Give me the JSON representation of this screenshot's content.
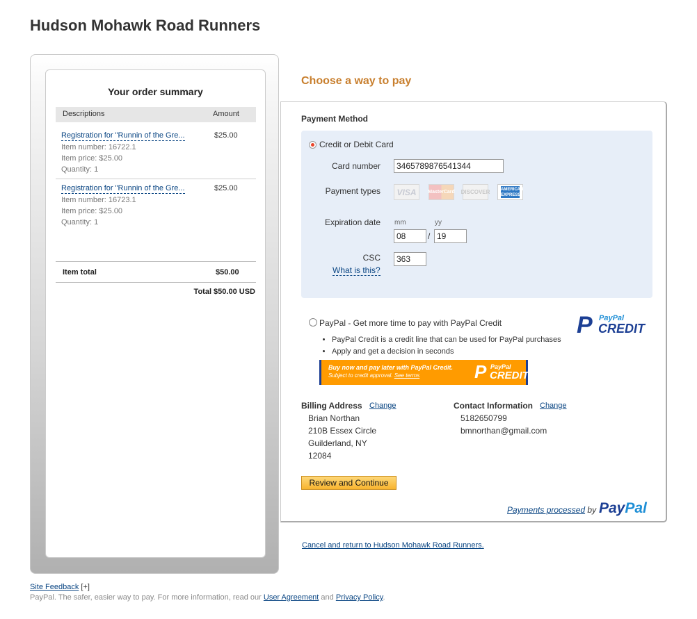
{
  "merchant": {
    "title": "Hudson Mohawk Road Runners"
  },
  "summary": {
    "title": "Your order summary",
    "col_desc": "Descriptions",
    "col_amount": "Amount",
    "items": [
      {
        "name": "Registration for \"Runnin of the Gre...",
        "amount": "$25.00",
        "item_number": "Item number: 16722.1",
        "item_price": "Item price: $25.00",
        "quantity": "Quantity: 1"
      },
      {
        "name": "Registration for \"Runnin of the Gre...",
        "amount": "$25.00",
        "item_number": "Item number: 16723.1",
        "item_price": "Item price: $25.00",
        "quantity": "Quantity: 1"
      }
    ],
    "item_total_label": "Item total",
    "item_total_value": "$50.00",
    "grand_total": "Total $50.00 USD"
  },
  "payment": {
    "choose_title": "Choose a way to pay",
    "method_heading": "Payment Method",
    "card_option": "Credit or Debit Card",
    "card_number_label": "Card number",
    "card_number_value": "3465789876541344",
    "payment_types_label": "Payment types",
    "card_types": [
      "VISA",
      "MasterCard",
      "DISCOVER",
      "AMERICAN EXPRESS"
    ],
    "expiration_label": "Expiration date",
    "mm_label": "mm",
    "yy_label": "yy",
    "mm_value": "08",
    "slash": "/",
    "yy_value": "19",
    "csc_label": "CSC",
    "csc_value": "363",
    "what_is_this": "What is this?",
    "paypal_option": "PayPal - Get more time to pay with PayPal Credit",
    "paypal_bullets": [
      "PayPal Credit is a credit line that can be used for PayPal purchases",
      "Apply and get a decision in seconds"
    ],
    "pp_credit_logo": {
      "p": "P",
      "paypal": "PayPal",
      "credit": "CREDIT"
    },
    "banner": {
      "line1": "Buy now and pay later with PayPal Credit.",
      "line2": "Subject to credit approval.",
      "see_terms": "See terms",
      "p": "P",
      "paypal": "PayPal",
      "credit": "CREDIT"
    }
  },
  "billing": {
    "heading": "Billing Address",
    "change": "Change",
    "lines": [
      "Brian Northan",
      "210B Essex Circle",
      "Guilderland, NY",
      "12084"
    ]
  },
  "contact": {
    "heading": "Contact Information",
    "change": "Change",
    "lines": [
      "5182650799",
      "bmnorthan@gmail.com"
    ]
  },
  "actions": {
    "review_button": "Review and Continue",
    "processed_link": "Payments processed",
    "processed_by": "by",
    "paypal_pay": "Pay",
    "paypal_pal": "Pal",
    "cancel_link": "Cancel and return to Hudson Mohawk Road Runners."
  },
  "footer": {
    "site_feedback": "Site Feedback",
    "expand": "[+]",
    "text_before": "PayPal. The safer, easier way to pay. For more information, read our",
    "user_agreement": "User Agreement",
    "and": "and",
    "privacy_policy": "Privacy Policy",
    "period": "."
  },
  "colors": {
    "accent": "#c87f2e",
    "link": "#084482",
    "panel": "#e7eef8",
    "paypal_dark": "#1c3f94",
    "paypal_light": "#1f8fd6",
    "button": "#f8b42f"
  }
}
